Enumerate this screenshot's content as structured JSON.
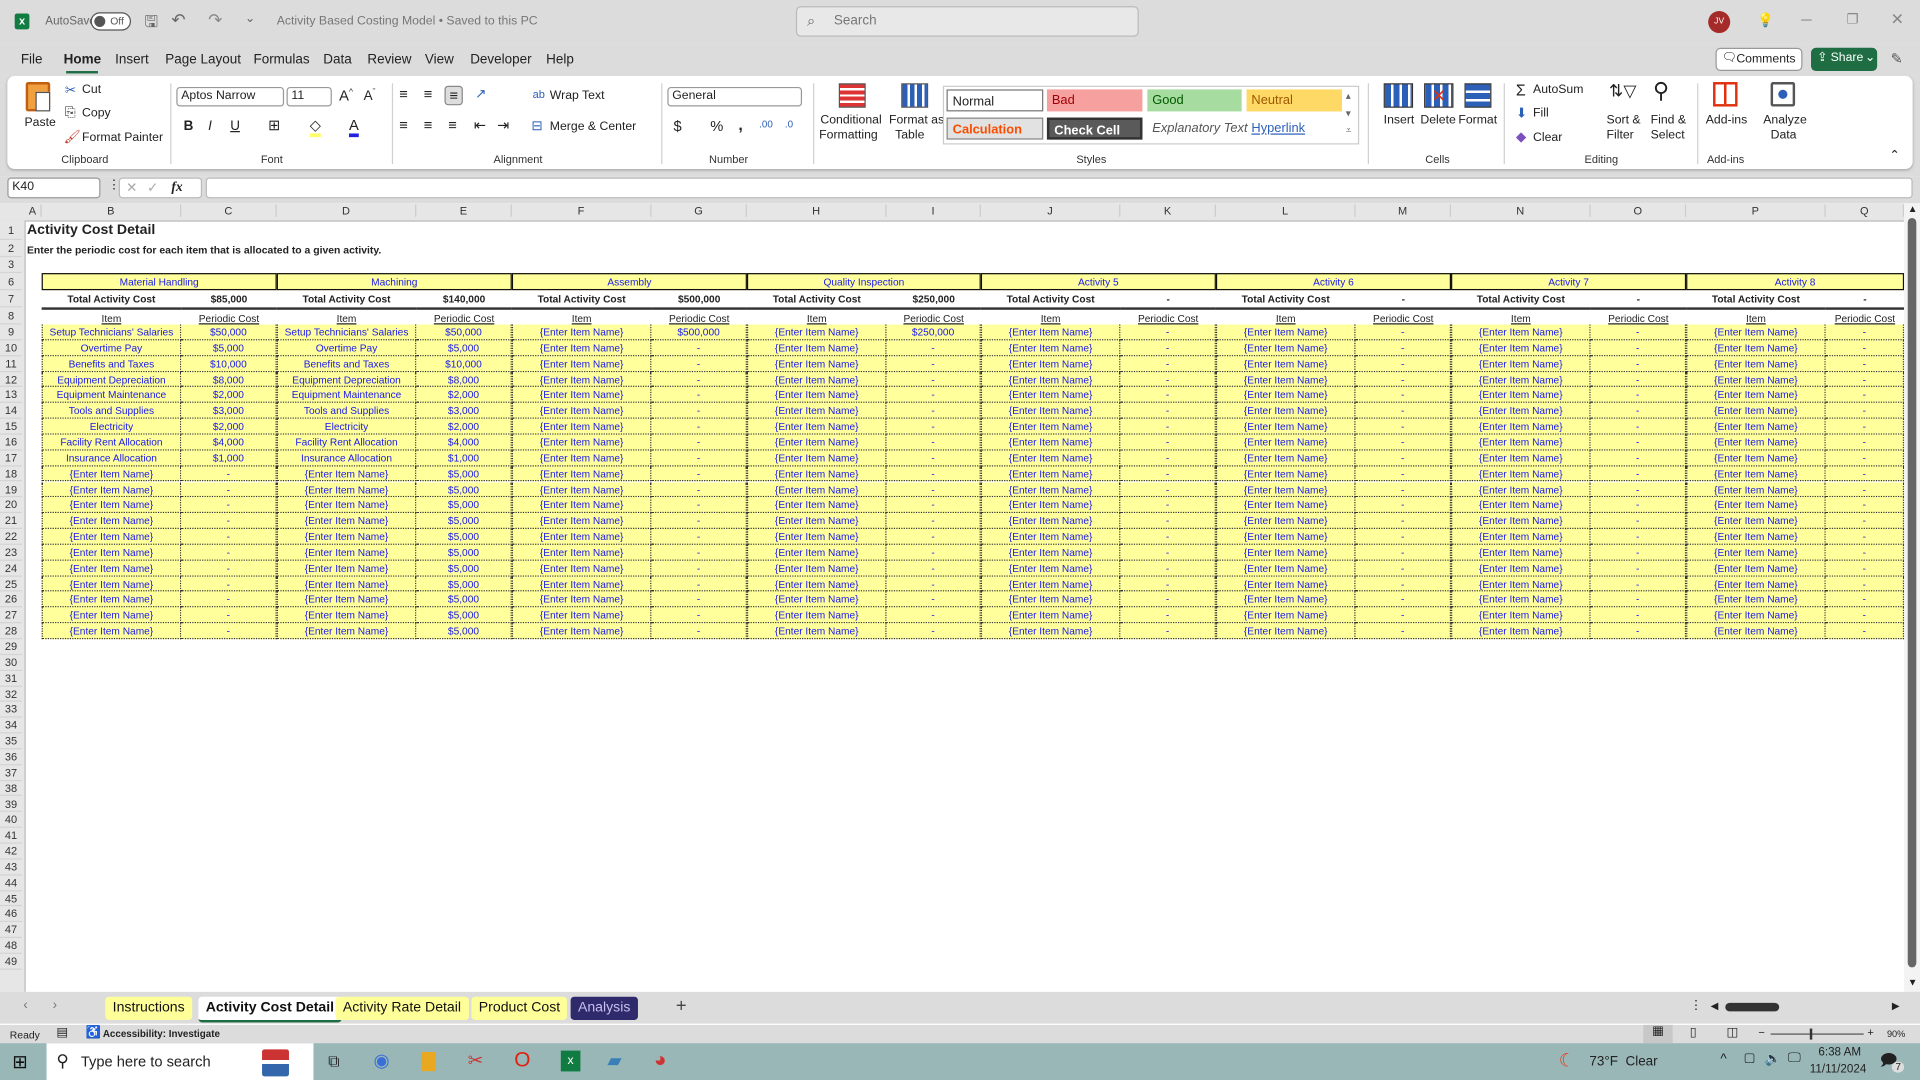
{
  "titlebar": {
    "autosave_label": "AutoSave",
    "autosave_state": "Off",
    "doc_title": "Activity Based Costing Model • Saved to this PC",
    "search_placeholder": "Search",
    "avatar_initials": "JV"
  },
  "menu": {
    "items": [
      "File",
      "Home",
      "Insert",
      "Page Layout",
      "Formulas",
      "Data",
      "Review",
      "View",
      "Developer",
      "Help"
    ],
    "active": "Home",
    "comments": "Comments",
    "share": "Share"
  },
  "ribbon": {
    "clipboard": {
      "paste": "Paste",
      "cut": "Cut",
      "copy": "Copy",
      "format_painter": "Format Painter",
      "label": "Clipboard"
    },
    "font": {
      "name": "Aptos Narrow",
      "size": "11",
      "label": "Font"
    },
    "alignment": {
      "wrap": "Wrap Text",
      "merge": "Merge & Center",
      "label": "Alignment"
    },
    "number": {
      "format": "General",
      "label": "Number"
    },
    "styles": {
      "cond1": "Conditional",
      "cond2": "Formatting",
      "fmt1": "Format as",
      "fmt2": "Table",
      "normal": "Normal",
      "bad": "Bad",
      "good": "Good",
      "neutral": "Neutral",
      "calculation": "Calculation",
      "check_cell": "Check Cell",
      "explanatory": "Explanatory Text",
      "hyperlink": "Hyperlink",
      "label": "Styles"
    },
    "cells": {
      "insert": "Insert",
      "delete": "Delete",
      "format": "Format",
      "label": "Cells"
    },
    "editing": {
      "autosum": "AutoSum",
      "fill": "Fill",
      "clear": "Clear",
      "sort1": "Sort &",
      "sort2": "Filter",
      "find1": "Find &",
      "find2": "Select",
      "label": "Editing"
    },
    "addins": {
      "addins": "Add-ins",
      "analyze1": "Analyze",
      "analyze2": "Data",
      "label": "Add-ins"
    }
  },
  "formula_bar": {
    "name_box": "K40",
    "fx": "fx",
    "value": ""
  },
  "columns": [
    "A",
    "B",
    "C",
    "D",
    "E",
    "F",
    "G",
    "H",
    "I",
    "J",
    "K",
    "L",
    "M",
    "N",
    "O",
    "P",
    "Q"
  ],
  "rows": [
    "1",
    "2",
    "3",
    "6",
    "7",
    "8",
    "9",
    "10",
    "11",
    "12",
    "13",
    "14",
    "15",
    "16",
    "17",
    "18",
    "19",
    "20",
    "21",
    "22",
    "23",
    "24",
    "25",
    "26",
    "27",
    "28",
    "29",
    "30",
    "31",
    "32",
    "33",
    "34",
    "35",
    "36",
    "37",
    "38",
    "39",
    "40",
    "41",
    "42",
    "43",
    "44",
    "45",
    "46",
    "47",
    "48",
    "49"
  ],
  "sheet": {
    "title": "Activity Cost Detail",
    "subtitle": "Enter the periodic cost for each item that is allocated to a given activity.",
    "total_label": "Total Activity Cost",
    "item_header": "Item",
    "cost_header": "Periodic Cost",
    "activities": [
      {
        "name": "Material Handling",
        "total": "$85,000",
        "items": [
          [
            "Setup Technicians' Salaries",
            "$50,000"
          ],
          [
            "Overtime Pay",
            "$5,000"
          ],
          [
            "Benefits and Taxes",
            "$10,000"
          ],
          [
            "Equipment Depreciation",
            "$8,000"
          ],
          [
            "Equipment Maintenance",
            "$2,000"
          ],
          [
            "Tools and Supplies",
            "$3,000"
          ],
          [
            "Electricity",
            "$2,000"
          ],
          [
            "Facility Rent Allocation",
            "$4,000"
          ],
          [
            "Insurance Allocation",
            "$1,000"
          ],
          [
            "{Enter Item Name}",
            "-"
          ],
          [
            "{Enter Item Name}",
            "-"
          ],
          [
            "{Enter Item Name}",
            "-"
          ],
          [
            "{Enter Item Name}",
            "-"
          ],
          [
            "{Enter Item Name}",
            "-"
          ],
          [
            "{Enter Item Name}",
            "-"
          ],
          [
            "{Enter Item Name}",
            "-"
          ],
          [
            "{Enter Item Name}",
            "-"
          ],
          [
            "{Enter Item Name}",
            "-"
          ],
          [
            "{Enter Item Name}",
            "-"
          ],
          [
            "{Enter Item Name}",
            "-"
          ]
        ]
      },
      {
        "name": "Machining",
        "total": "$140,000",
        "items": [
          [
            "Setup Technicians' Salaries",
            "$50,000"
          ],
          [
            "Overtime Pay",
            "$5,000"
          ],
          [
            "Benefits and Taxes",
            "$10,000"
          ],
          [
            "Equipment Depreciation",
            "$8,000"
          ],
          [
            "Equipment Maintenance",
            "$2,000"
          ],
          [
            "Tools and Supplies",
            "$3,000"
          ],
          [
            "Electricity",
            "$2,000"
          ],
          [
            "Facility Rent Allocation",
            "$4,000"
          ],
          [
            "Insurance Allocation",
            "$1,000"
          ],
          [
            "{Enter Item Name}",
            "$5,000"
          ],
          [
            "{Enter Item Name}",
            "$5,000"
          ],
          [
            "{Enter Item Name}",
            "$5,000"
          ],
          [
            "{Enter Item Name}",
            "$5,000"
          ],
          [
            "{Enter Item Name}",
            "$5,000"
          ],
          [
            "{Enter Item Name}",
            "$5,000"
          ],
          [
            "{Enter Item Name}",
            "$5,000"
          ],
          [
            "{Enter Item Name}",
            "$5,000"
          ],
          [
            "{Enter Item Name}",
            "$5,000"
          ],
          [
            "{Enter Item Name}",
            "$5,000"
          ],
          [
            "{Enter Item Name}",
            "$5,000"
          ]
        ]
      },
      {
        "name": "Assembly",
        "total": "$500,000",
        "items": [
          [
            "{Enter Item Name}",
            "$500,000"
          ],
          [
            "{Enter Item Name}",
            "-"
          ],
          [
            "{Enter Item Name}",
            "-"
          ],
          [
            "{Enter Item Name}",
            "-"
          ],
          [
            "{Enter Item Name}",
            "-"
          ],
          [
            "{Enter Item Name}",
            "-"
          ],
          [
            "{Enter Item Name}",
            "-"
          ],
          [
            "{Enter Item Name}",
            "-"
          ],
          [
            "{Enter Item Name}",
            "-"
          ],
          [
            "{Enter Item Name}",
            "-"
          ],
          [
            "{Enter Item Name}",
            "-"
          ],
          [
            "{Enter Item Name}",
            "-"
          ],
          [
            "{Enter Item Name}",
            "-"
          ],
          [
            "{Enter Item Name}",
            "-"
          ],
          [
            "{Enter Item Name}",
            "-"
          ],
          [
            "{Enter Item Name}",
            "-"
          ],
          [
            "{Enter Item Name}",
            "-"
          ],
          [
            "{Enter Item Name}",
            "-"
          ],
          [
            "{Enter Item Name}",
            "-"
          ],
          [
            "{Enter Item Name}",
            "-"
          ]
        ]
      },
      {
        "name": "Quality Inspection",
        "total": "$250,000",
        "items": [
          [
            "{Enter Item Name}",
            "$250,000"
          ],
          [
            "{Enter Item Name}",
            "-"
          ],
          [
            "{Enter Item Name}",
            "-"
          ],
          [
            "{Enter Item Name}",
            "-"
          ],
          [
            "{Enter Item Name}",
            "-"
          ],
          [
            "{Enter Item Name}",
            "-"
          ],
          [
            "{Enter Item Name}",
            "-"
          ],
          [
            "{Enter Item Name}",
            "-"
          ],
          [
            "{Enter Item Name}",
            "-"
          ],
          [
            "{Enter Item Name}",
            "-"
          ],
          [
            "{Enter Item Name}",
            "-"
          ],
          [
            "{Enter Item Name}",
            "-"
          ],
          [
            "{Enter Item Name}",
            "-"
          ],
          [
            "{Enter Item Name}",
            "-"
          ],
          [
            "{Enter Item Name}",
            "-"
          ],
          [
            "{Enter Item Name}",
            "-"
          ],
          [
            "{Enter Item Name}",
            "-"
          ],
          [
            "{Enter Item Name}",
            "-"
          ],
          [
            "{Enter Item Name}",
            "-"
          ],
          [
            "{Enter Item Name}",
            "-"
          ]
        ]
      },
      {
        "name": "Activity 5",
        "total": "-",
        "items": [
          [
            "{Enter Item Name}",
            "-"
          ],
          [
            "{Enter Item Name}",
            "-"
          ],
          [
            "{Enter Item Name}",
            "-"
          ],
          [
            "{Enter Item Name}",
            "-"
          ],
          [
            "{Enter Item Name}",
            "-"
          ],
          [
            "{Enter Item Name}",
            "-"
          ],
          [
            "{Enter Item Name}",
            "-"
          ],
          [
            "{Enter Item Name}",
            "-"
          ],
          [
            "{Enter Item Name}",
            "-"
          ],
          [
            "{Enter Item Name}",
            "-"
          ],
          [
            "{Enter Item Name}",
            "-"
          ],
          [
            "{Enter Item Name}",
            "-"
          ],
          [
            "{Enter Item Name}",
            "-"
          ],
          [
            "{Enter Item Name}",
            "-"
          ],
          [
            "{Enter Item Name}",
            "-"
          ],
          [
            "{Enter Item Name}",
            "-"
          ],
          [
            "{Enter Item Name}",
            "-"
          ],
          [
            "{Enter Item Name}",
            "-"
          ],
          [
            "{Enter Item Name}",
            "-"
          ],
          [
            "{Enter Item Name}",
            "-"
          ]
        ]
      },
      {
        "name": "Activity 6",
        "total": "-",
        "items": [
          [
            "{Enter Item Name}",
            "-"
          ],
          [
            "{Enter Item Name}",
            "-"
          ],
          [
            "{Enter Item Name}",
            "-"
          ],
          [
            "{Enter Item Name}",
            "-"
          ],
          [
            "{Enter Item Name}",
            "-"
          ],
          [
            "{Enter Item Name}",
            "-"
          ],
          [
            "{Enter Item Name}",
            "-"
          ],
          [
            "{Enter Item Name}",
            "-"
          ],
          [
            "{Enter Item Name}",
            "-"
          ],
          [
            "{Enter Item Name}",
            "-"
          ],
          [
            "{Enter Item Name}",
            "-"
          ],
          [
            "{Enter Item Name}",
            "-"
          ],
          [
            "{Enter Item Name}",
            "-"
          ],
          [
            "{Enter Item Name}",
            "-"
          ],
          [
            "{Enter Item Name}",
            "-"
          ],
          [
            "{Enter Item Name}",
            "-"
          ],
          [
            "{Enter Item Name}",
            "-"
          ],
          [
            "{Enter Item Name}",
            "-"
          ],
          [
            "{Enter Item Name}",
            "-"
          ],
          [
            "{Enter Item Name}",
            "-"
          ]
        ]
      },
      {
        "name": "Activity 7",
        "total": "-",
        "items": [
          [
            "{Enter Item Name}",
            "-"
          ],
          [
            "{Enter Item Name}",
            "-"
          ],
          [
            "{Enter Item Name}",
            "-"
          ],
          [
            "{Enter Item Name}",
            "-"
          ],
          [
            "{Enter Item Name}",
            "-"
          ],
          [
            "{Enter Item Name}",
            "-"
          ],
          [
            "{Enter Item Name}",
            "-"
          ],
          [
            "{Enter Item Name}",
            "-"
          ],
          [
            "{Enter Item Name}",
            "-"
          ],
          [
            "{Enter Item Name}",
            "-"
          ],
          [
            "{Enter Item Name}",
            "-"
          ],
          [
            "{Enter Item Name}",
            "-"
          ],
          [
            "{Enter Item Name}",
            "-"
          ],
          [
            "{Enter Item Name}",
            "-"
          ],
          [
            "{Enter Item Name}",
            "-"
          ],
          [
            "{Enter Item Name}",
            "-"
          ],
          [
            "{Enter Item Name}",
            "-"
          ],
          [
            "{Enter Item Name}",
            "-"
          ],
          [
            "{Enter Item Name}",
            "-"
          ],
          [
            "{Enter Item Name}",
            "-"
          ]
        ]
      },
      {
        "name": "Activity 8",
        "total": "-",
        "items": [
          [
            "{Enter Item Name}",
            "-"
          ],
          [
            "{Enter Item Name}",
            "-"
          ],
          [
            "{Enter Item Name}",
            "-"
          ],
          [
            "{Enter Item Name}",
            "-"
          ],
          [
            "{Enter Item Name}",
            "-"
          ],
          [
            "{Enter Item Name}",
            "-"
          ],
          [
            "{Enter Item Name}",
            "-"
          ],
          [
            "{Enter Item Name}",
            "-"
          ],
          [
            "{Enter Item Name}",
            "-"
          ],
          [
            "{Enter Item Name}",
            "-"
          ],
          [
            "{Enter Item Name}",
            "-"
          ],
          [
            "{Enter Item Name}",
            "-"
          ],
          [
            "{Enter Item Name}",
            "-"
          ],
          [
            "{Enter Item Name}",
            "-"
          ],
          [
            "{Enter Item Name}",
            "-"
          ],
          [
            "{Enter Item Name}",
            "-"
          ],
          [
            "{Enter Item Name}",
            "-"
          ],
          [
            "{Enter Item Name}",
            "-"
          ],
          [
            "{Enter Item Name}",
            "-"
          ],
          [
            "{Enter Item Name}",
            "-"
          ]
        ]
      }
    ]
  },
  "sheet_tabs": [
    {
      "label": "Instructions",
      "color": "#ffff99"
    },
    {
      "label": "Activity Cost Detail",
      "color": "#ffffff",
      "active": true
    },
    {
      "label": "Activity Rate Detail",
      "color": "#ffff99"
    },
    {
      "label": "Product Cost",
      "color": "#ffff99"
    },
    {
      "label": "Analysis",
      "color": "#2e2a6b"
    }
  ],
  "status": {
    "ready": "Ready",
    "accessibility": "Accessibility: Investigate",
    "zoom": "90%"
  },
  "taskbar": {
    "search_placeholder": "Type here to search",
    "weather": "73°F  Clear",
    "time": "6:38 AM",
    "date": "11/11/2024",
    "notifications": "7"
  },
  "colors": {
    "fill_yellow": "#ffff9c",
    "text_blue": "#1a1aee",
    "share_green": "#1f6e43",
    "analysis_tab": "#2e2a6b"
  }
}
